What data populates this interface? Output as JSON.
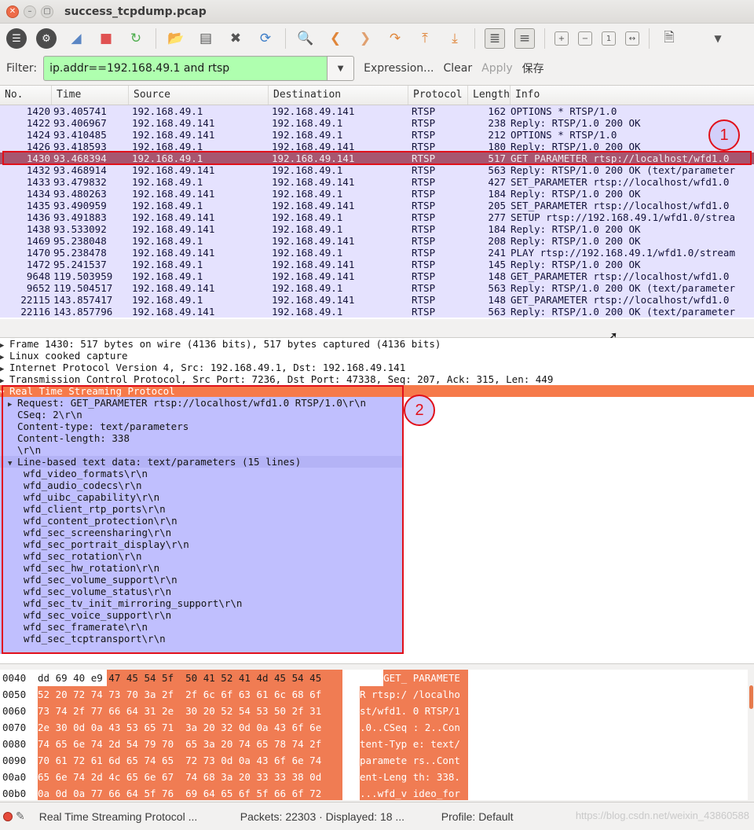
{
  "window": {
    "title": "success_tcpdump.pcap"
  },
  "filter": {
    "label": "Filter:",
    "value": "ip.addr==192.168.49.1 and rtsp",
    "expression": "Expression...",
    "clear": "Clear",
    "apply": "Apply",
    "save": "保存"
  },
  "columns": [
    "No.",
    "Time",
    "Source",
    "Destination",
    "Protocol",
    "Length",
    "Info"
  ],
  "packets": [
    {
      "no": "1420",
      "time": "93.405741",
      "src": "192.168.49.1",
      "dst": "192.168.49.141",
      "proto": "RTSP",
      "len": "162",
      "info": "OPTIONS * RTSP/1.0"
    },
    {
      "no": "1422",
      "time": "93.406967",
      "src": "192.168.49.141",
      "dst": "192.168.49.1",
      "proto": "RTSP",
      "len": "238",
      "info": "Reply: RTSP/1.0 200 OK"
    },
    {
      "no": "1424",
      "time": "93.410485",
      "src": "192.168.49.141",
      "dst": "192.168.49.1",
      "proto": "RTSP",
      "len": "212",
      "info": "OPTIONS * RTSP/1.0"
    },
    {
      "no": "1426",
      "time": "93.418593",
      "src": "192.168.49.1",
      "dst": "192.168.49.141",
      "proto": "RTSP",
      "len": "180",
      "info": "Reply: RTSP/1.0 200 OK"
    },
    {
      "no": "1430",
      "time": "93.468394",
      "src": "192.168.49.1",
      "dst": "192.168.49.141",
      "proto": "RTSP",
      "len": "517",
      "info": "GET_PARAMETER rtsp://localhost/wfd1.0"
    },
    {
      "no": "1432",
      "time": "93.468914",
      "src": "192.168.49.141",
      "dst": "192.168.49.1",
      "proto": "RTSP",
      "len": "563",
      "info": "Reply: RTSP/1.0 200 OK (text/parameter"
    },
    {
      "no": "1433",
      "time": "93.479832",
      "src": "192.168.49.1",
      "dst": "192.168.49.141",
      "proto": "RTSP",
      "len": "427",
      "info": "SET_PARAMETER rtsp://localhost/wfd1.0"
    },
    {
      "no": "1434",
      "time": "93.480263",
      "src": "192.168.49.141",
      "dst": "192.168.49.1",
      "proto": "RTSP",
      "len": "184",
      "info": "Reply: RTSP/1.0 200 OK"
    },
    {
      "no": "1435",
      "time": "93.490959",
      "src": "192.168.49.1",
      "dst": "192.168.49.141",
      "proto": "RTSP",
      "len": "205",
      "info": "SET_PARAMETER rtsp://localhost/wfd1.0"
    },
    {
      "no": "1436",
      "time": "93.491883",
      "src": "192.168.49.141",
      "dst": "192.168.49.1",
      "proto": "RTSP",
      "len": "277",
      "info": "SETUP rtsp://192.168.49.1/wfd1.0/strea"
    },
    {
      "no": "1438",
      "time": "93.533092",
      "src": "192.168.49.141",
      "dst": "192.168.49.1",
      "proto": "RTSP",
      "len": "184",
      "info": "Reply: RTSP/1.0 200 OK"
    },
    {
      "no": "1469",
      "time": "95.238048",
      "src": "192.168.49.1",
      "dst": "192.168.49.141",
      "proto": "RTSP",
      "len": "208",
      "info": "Reply: RTSP/1.0 200 OK"
    },
    {
      "no": "1470",
      "time": "95.238478",
      "src": "192.168.49.141",
      "dst": "192.168.49.1",
      "proto": "RTSP",
      "len": "241",
      "info": "PLAY rtsp://192.168.49.1/wfd1.0/stream"
    },
    {
      "no": "1472",
      "time": "95.241537",
      "src": "192.168.49.1",
      "dst": "192.168.49.141",
      "proto": "RTSP",
      "len": "145",
      "info": "Reply: RTSP/1.0 200 OK"
    },
    {
      "no": "9648",
      "time": "119.503959",
      "src": "192.168.49.1",
      "dst": "192.168.49.141",
      "proto": "RTSP",
      "len": "148",
      "info": "GET_PARAMETER rtsp://localhost/wfd1.0"
    },
    {
      "no": "9652",
      "time": "119.504517",
      "src": "192.168.49.141",
      "dst": "192.168.49.1",
      "proto": "RTSP",
      "len": "563",
      "info": "Reply: RTSP/1.0 200 OK (text/parameter"
    },
    {
      "no": "22115",
      "time": "143.857417",
      "src": "192.168.49.1",
      "dst": "192.168.49.141",
      "proto": "RTSP",
      "len": "148",
      "info": "GET_PARAMETER rtsp://localhost/wfd1.0"
    },
    {
      "no": "22116",
      "time": "143.857796",
      "src": "192.168.49.141",
      "dst": "192.168.49.1",
      "proto": "RTSP",
      "len": "563",
      "info": "Reply: RTSP/1.0 200 OK (text/parameter"
    }
  ],
  "selected_index": 4,
  "details": {
    "frame": "Frame 1430: 517 bytes on wire (4136 bits), 517 bytes captured (4136 bits)",
    "sll": "Linux cooked capture",
    "ip": "Internet Protocol Version 4, Src: 192.168.49.1, Dst: 192.168.49.141",
    "tcp": "Transmission Control Protocol, Src Port: 7236, Dst Port: 47338, Seq: 207, Ack: 315, Len: 449",
    "rtsp": "Real Time Streaming Protocol",
    "rtsp_fields": [
      "Request: GET_PARAMETER rtsp://localhost/wfd1.0 RTSP/1.0\\r\\n",
      "CSeq: 2\\r\\n",
      "Content-type: text/parameters",
      "Content-length: 338",
      "\\r\\n"
    ],
    "linetext": "Line-based text data: text/parameters (15 lines)",
    "lines": [
      "wfd_video_formats\\r\\n",
      "wfd_audio_codecs\\r\\n",
      "wfd_uibc_capability\\r\\n",
      "wfd_client_rtp_ports\\r\\n",
      "wfd_content_protection\\r\\n",
      "wfd_sec_screensharing\\r\\n",
      "wfd_sec_portrait_display\\r\\n",
      "wfd_sec_rotation\\r\\n",
      "wfd_sec_hw_rotation\\r\\n",
      "wfd_sec_volume_support\\r\\n",
      "wfd_sec_volume_status\\r\\n",
      "wfd_sec_tv_init_mirroring_support\\r\\n",
      "wfd_sec_voice_support\\r\\n",
      "wfd_sec_framerate\\r\\n",
      "wfd_sec_tcptransport\\r\\n"
    ]
  },
  "hex": [
    {
      "off": "0040",
      "hex": "dd 69 40 e9 47 45 54 5f  50 41 52 41 4d 45 54 45",
      "ascii": ".i@.GET_ PARAMETE",
      "hl_start": 4
    },
    {
      "off": "0050",
      "hex": "52 20 72 74 73 70 3a 2f  2f 6c 6f 63 61 6c 68 6f",
      "ascii": "R rtsp:/ /localho",
      "hl_start": 0
    },
    {
      "off": "0060",
      "hex": "73 74 2f 77 66 64 31 2e  30 20 52 54 53 50 2f 31",
      "ascii": "st/wfd1. 0 RTSP/1",
      "hl_start": 0
    },
    {
      "off": "0070",
      "hex": "2e 30 0d 0a 43 53 65 71  3a 20 32 0d 0a 43 6f 6e",
      "ascii": ".0..CSeq : 2..Con",
      "hl_start": 0
    },
    {
      "off": "0080",
      "hex": "74 65 6e 74 2d 54 79 70  65 3a 20 74 65 78 74 2f",
      "ascii": "tent-Typ e: text/",
      "hl_start": 0
    },
    {
      "off": "0090",
      "hex": "70 61 72 61 6d 65 74 65  72 73 0d 0a 43 6f 6e 74",
      "ascii": "paramete rs..Cont",
      "hl_start": 0
    },
    {
      "off": "00a0",
      "hex": "65 6e 74 2d 4c 65 6e 67  74 68 3a 20 33 33 38 0d",
      "ascii": "ent-Leng th: 338.",
      "hl_start": 0
    },
    {
      "off": "00b0",
      "hex": "0a 0d 0a 77 66 64 5f 76  69 64 65 6f 5f 66 6f 72",
      "ascii": "...wfd_v ideo_for",
      "hl_start": 0
    }
  ],
  "status": {
    "field": "Real Time Streaming Protocol ...",
    "packets": "Packets: 22303 · Displayed: 18 ...",
    "profile": "Profile: Default"
  },
  "annotations": {
    "badge1": "1",
    "badge2": "2"
  },
  "watermark": "https://blog.csdn.net/weixin_43860588",
  "colors": {
    "row_bg": "#e5e2fe",
    "selected_row": "#a75670",
    "filter_ok": "#afffaf",
    "highlight": "#f07c53",
    "annotation": "#e1101a"
  }
}
